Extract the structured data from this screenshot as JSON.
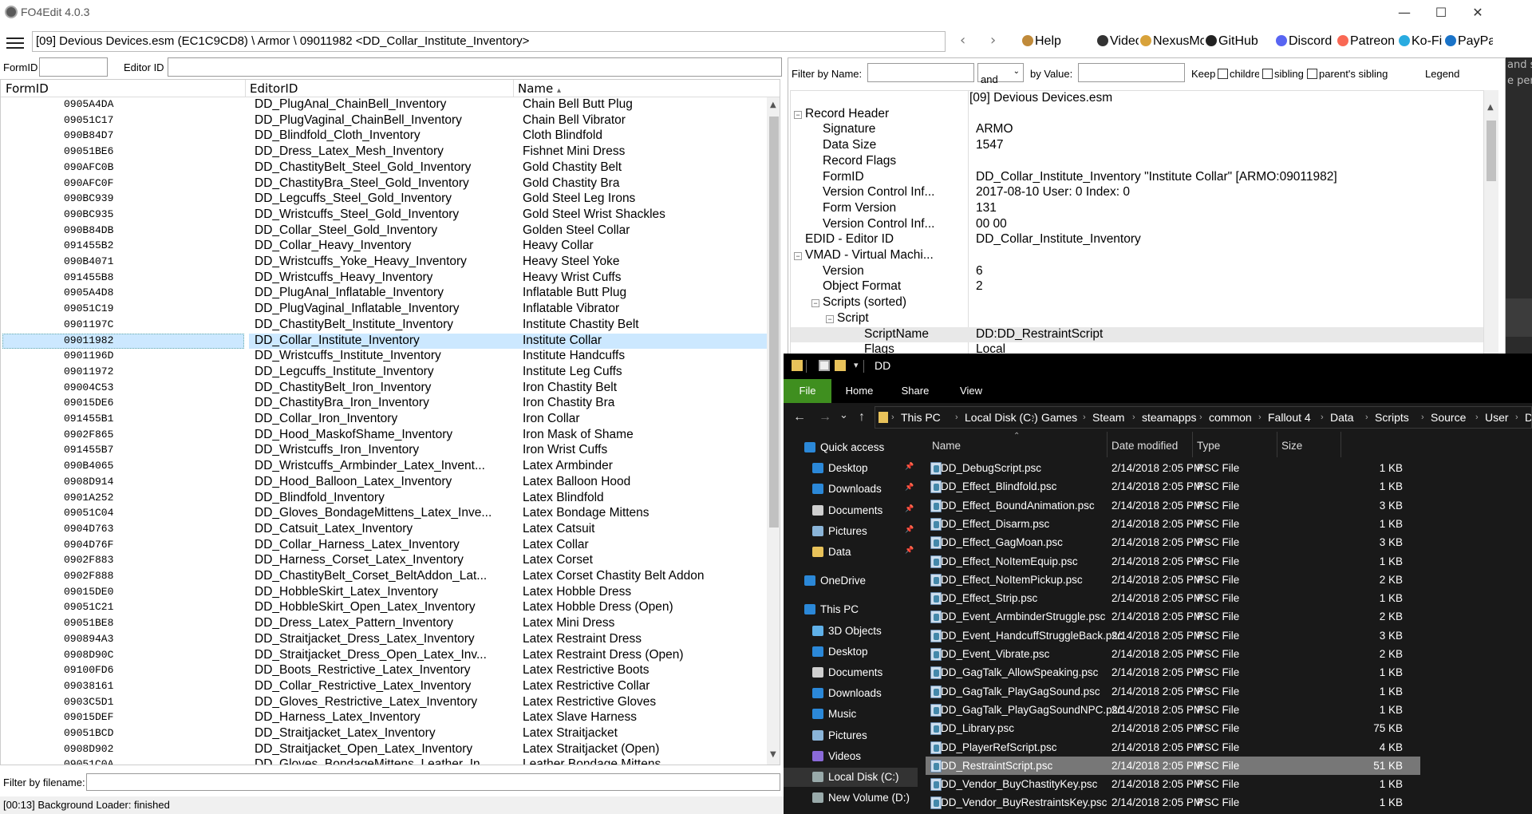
{
  "app": {
    "title": "FO4Edit 4.0.3",
    "path": "[09] Devious Devices.esm (EC1C9CD8) \\ Armor \\ 09011982 <DD_Collar_Institute_Inventory>",
    "window_controls": {
      "minimize": "—",
      "maximize": "☐",
      "close": "✕"
    },
    "nav_back": "‹",
    "nav_forward": "›",
    "links": [
      {
        "label": "Help",
        "icon": "book-icon"
      },
      {
        "label": "Videos",
        "icon": "video-icon"
      },
      {
        "label": "NexusMods",
        "icon": "nexus-icon"
      },
      {
        "label": "GitHub",
        "icon": "github-icon"
      },
      {
        "label": "Discord",
        "icon": "discord-icon"
      },
      {
        "label": "Patreon",
        "icon": "patreon-icon"
      },
      {
        "label": "Ko-Fi",
        "icon": "kofi-icon"
      },
      {
        "label": "PayPal",
        "icon": "paypal-icon"
      }
    ]
  },
  "filters": {
    "formid_label": "FormID",
    "editorid_label": "Editor ID",
    "filename_label": "Filter by filename:"
  },
  "list": {
    "columns": {
      "formid": "FormID",
      "editorid": "EditorID",
      "name": "Name",
      "sort_arrow": "▴"
    },
    "rows": [
      {
        "formid": "0905A4DA",
        "editorid": "DD_PlugAnal_ChainBell_Inventory",
        "name": "Chain Bell Butt Plug"
      },
      {
        "formid": "09051C17",
        "editorid": "DD_PlugVaginal_ChainBell_Inventory",
        "name": "Chain Bell Vibrator"
      },
      {
        "formid": "090B84D7",
        "editorid": "DD_Blindfold_Cloth_Inventory",
        "name": "Cloth Blindfold"
      },
      {
        "formid": "09051BE6",
        "editorid": "DD_Dress_Latex_Mesh_Inventory",
        "name": "Fishnet Mini Dress"
      },
      {
        "formid": "090AFC0B",
        "editorid": "DD_ChastityBelt_Steel_Gold_Inventory",
        "name": "Gold Chastity Belt"
      },
      {
        "formid": "090AFC0F",
        "editorid": "DD_ChastityBra_Steel_Gold_Inventory",
        "name": "Gold Chastity Bra"
      },
      {
        "formid": "090BC939",
        "editorid": "DD_Legcuffs_Steel_Gold_Inventory",
        "name": "Gold Steel Leg Irons"
      },
      {
        "formid": "090BC935",
        "editorid": "DD_Wristcuffs_Steel_Gold_Inventory",
        "name": "Gold Steel Wrist Shackles"
      },
      {
        "formid": "090B84DB",
        "editorid": "DD_Collar_Steel_Gold_Inventory",
        "name": "Golden Steel Collar"
      },
      {
        "formid": "091455B2",
        "editorid": "DD_Collar_Heavy_Inventory",
        "name": "Heavy Collar"
      },
      {
        "formid": "090B4071",
        "editorid": "DD_Wristcuffs_Yoke_Heavy_Inventory",
        "name": "Heavy Steel Yoke"
      },
      {
        "formid": "091455B8",
        "editorid": "DD_Wristcuffs_Heavy_Inventory",
        "name": "Heavy Wrist Cuffs"
      },
      {
        "formid": "0905A4D8",
        "editorid": "DD_PlugAnal_Inflatable_Inventory",
        "name": "Inflatable Butt Plug"
      },
      {
        "formid": "09051C19",
        "editorid": "DD_PlugVaginal_Inflatable_Inventory",
        "name": "Inflatable Vibrator"
      },
      {
        "formid": "0901197C",
        "editorid": "DD_ChastityBelt_Institute_Inventory",
        "name": "Institute Chastity Belt"
      },
      {
        "formid": "09011982",
        "editorid": "DD_Collar_Institute_Inventory",
        "name": "Institute Collar",
        "selected": true
      },
      {
        "formid": "0901196D",
        "editorid": "DD_Wristcuffs_Institute_Inventory",
        "name": "Institute Handcuffs"
      },
      {
        "formid": "09011972",
        "editorid": "DD_Legcuffs_Institute_Inventory",
        "name": "Institute Leg Cuffs"
      },
      {
        "formid": "09004C53",
        "editorid": "DD_ChastityBelt_Iron_Inventory",
        "name": "Iron Chastity Belt"
      },
      {
        "formid": "09015DE6",
        "editorid": "DD_ChastityBra_Iron_Inventory",
        "name": "Iron Chastity Bra"
      },
      {
        "formid": "091455B1",
        "editorid": "DD_Collar_Iron_Inventory",
        "name": "Iron Collar"
      },
      {
        "formid": "0902F865",
        "editorid": "DD_Hood_MaskofShame_Inventory",
        "name": "Iron Mask of Shame"
      },
      {
        "formid": "091455B7",
        "editorid": "DD_Wristcuffs_Iron_Inventory",
        "name": "Iron Wrist Cuffs"
      },
      {
        "formid": "090B4065",
        "editorid": "DD_Wristcuffs_Armbinder_Latex_Invent...",
        "name": "Latex Armbinder"
      },
      {
        "formid": "0908D914",
        "editorid": "DD_Hood_Balloon_Latex_Inventory",
        "name": "Latex Balloon Hood"
      },
      {
        "formid": "0901A252",
        "editorid": "DD_Blindfold_Inventory",
        "name": "Latex Blindfold"
      },
      {
        "formid": "09051C04",
        "editorid": "DD_Gloves_BondageMittens_Latex_Inve...",
        "name": "Latex Bondage Mittens"
      },
      {
        "formid": "0904D763",
        "editorid": "DD_Catsuit_Latex_Inventory",
        "name": "Latex Catsuit"
      },
      {
        "formid": "0904D76F",
        "editorid": "DD_Collar_Harness_Latex_Inventory",
        "name": "Latex Collar"
      },
      {
        "formid": "0902F883",
        "editorid": "DD_Harness_Corset_Latex_Inventory",
        "name": "Latex Corset"
      },
      {
        "formid": "0902F888",
        "editorid": "DD_ChastityBelt_Corset_BeltAddon_Lat...",
        "name": "Latex Corset Chastity Belt Addon"
      },
      {
        "formid": "09015DE0",
        "editorid": "DD_HobbleSkirt_Latex_Inventory",
        "name": "Latex Hobble Dress"
      },
      {
        "formid": "09051C21",
        "editorid": "DD_HobbleSkirt_Open_Latex_Inventory",
        "name": "Latex Hobble Dress (Open)"
      },
      {
        "formid": "09051BE8",
        "editorid": "DD_Dress_Latex_Pattern_Inventory",
        "name": "Latex Mini Dress"
      },
      {
        "formid": "090894A3",
        "editorid": "DD_Straitjacket_Dress_Latex_Inventory",
        "name": "Latex Restraint Dress"
      },
      {
        "formid": "0908D90C",
        "editorid": "DD_Straitjacket_Dress_Open_Latex_Inv...",
        "name": "Latex Restraint Dress (Open)"
      },
      {
        "formid": "09100FD6",
        "editorid": "DD_Boots_Restrictive_Latex_Inventory",
        "name": "Latex Restrictive Boots"
      },
      {
        "formid": "09038161",
        "editorid": "DD_Collar_Restrictive_Latex_Inventory",
        "name": "Latex Restrictive Collar"
      },
      {
        "formid": "0903C5D1",
        "editorid": "DD_Gloves_Restrictive_Latex_Inventory",
        "name": "Latex Restrictive Gloves"
      },
      {
        "formid": "09015DEF",
        "editorid": "DD_Harness_Latex_Inventory",
        "name": "Latex Slave Harness"
      },
      {
        "formid": "09051BCD",
        "editorid": "DD_Straitjacket_Latex_Inventory",
        "name": "Latex Straitjacket"
      },
      {
        "formid": "0908D902",
        "editorid": "DD_Straitjacket_Open_Latex_Inventory",
        "name": "Latex Straitjacket (Open)"
      },
      {
        "formid": "09051C0A",
        "editorid": "DD_Gloves_BondageMittens_Leather_In...",
        "name": "Leather Bondage Mittens"
      }
    ]
  },
  "record": {
    "filter_by_name": "Filter by Name:",
    "and_option": "and",
    "by_value": "by Value:",
    "keep": "Keep",
    "children": "children",
    "siblings": "siblings",
    "parents_sibling": "parent's sibling",
    "legend": "Legend",
    "plugin_header": "[09] Devious Devices.esm",
    "rows": [
      {
        "label": "Record Header",
        "value": "",
        "indent": 0,
        "toggle": "−"
      },
      {
        "label": "Signature",
        "value": "ARMO",
        "indent": 1
      },
      {
        "label": "Data Size",
        "value": "1547",
        "indent": 1
      },
      {
        "label": "Record Flags",
        "value": "",
        "indent": 1
      },
      {
        "label": "FormID",
        "value": "DD_Collar_Institute_Inventory \"Institute Collar\" [ARMO:09011982]",
        "indent": 1
      },
      {
        "label": "Version Control Inf...",
        "value": "2017-08-10 User: 0 Index: 0",
        "indent": 1
      },
      {
        "label": "Form Version",
        "value": "131",
        "indent": 1
      },
      {
        "label": "Version Control Inf...",
        "value": "00 00",
        "indent": 1
      },
      {
        "label": "EDID - Editor ID",
        "value": "DD_Collar_Institute_Inventory",
        "indent": 0
      },
      {
        "label": "VMAD - Virtual Machi...",
        "value": "",
        "indent": 0,
        "toggle": "−"
      },
      {
        "label": "Version",
        "value": "6",
        "indent": 1
      },
      {
        "label": "Object Format",
        "value": "2",
        "indent": 1
      },
      {
        "label": "Scripts (sorted)",
        "value": "",
        "indent": 1,
        "toggle": "−"
      },
      {
        "label": "Script",
        "value": "",
        "indent": 2,
        "toggle": "−"
      },
      {
        "label": "ScriptName",
        "value": "DD:DD_RestraintScript",
        "indent": 3,
        "highlight": true
      },
      {
        "label": "Flags",
        "value": "Local",
        "indent": 3
      }
    ]
  },
  "side_text": {
    "line1": "and sk",
    "line2": "e pers"
  },
  "status": "[00:13] Background Loader: finished",
  "explorer": {
    "title": "DD",
    "ribbon": [
      "File",
      "Home",
      "Share",
      "View"
    ],
    "nav": {
      "back": "←",
      "forward": "→",
      "down": "⌄",
      "up": "↑"
    },
    "breadcrumbs": [
      "This PC",
      "Local Disk (C:)",
      "Games",
      "Steam",
      "steamapps",
      "common",
      "Fallout 4",
      "Data",
      "Scripts",
      "Source",
      "User",
      "DD"
    ],
    "columns": {
      "name": "Name",
      "date": "Date modified",
      "type": "Type",
      "size": "Size"
    },
    "nav_items": [
      {
        "label": "Quick access",
        "icon": "star-icon",
        "pinned": false,
        "indent": 0,
        "color": "#2b88d8"
      },
      {
        "label": "Desktop",
        "icon": "desktop-icon",
        "pinned": true,
        "indent": 1,
        "color": "#2b88d8"
      },
      {
        "label": "Downloads",
        "icon": "downloads-icon",
        "pinned": true,
        "indent": 1,
        "color": "#2b88d8"
      },
      {
        "label": "Documents",
        "icon": "documents-icon",
        "pinned": true,
        "indent": 1,
        "color": "#cfcfcf"
      },
      {
        "label": "Pictures",
        "icon": "pictures-icon",
        "pinned": true,
        "indent": 1,
        "color": "#8ab4d8"
      },
      {
        "label": "Data",
        "icon": "folder-icon",
        "pinned": true,
        "indent": 1,
        "color": "#e8c25a"
      },
      {
        "label": "OneDrive",
        "icon": "cloud-icon",
        "pinned": false,
        "indent": 0,
        "color": "#2b88d8"
      },
      {
        "label": "This PC",
        "icon": "computer-icon",
        "pinned": false,
        "indent": 0,
        "color": "#2b88d8"
      },
      {
        "label": "3D Objects",
        "icon": "cube-icon",
        "pinned": false,
        "indent": 1,
        "color": "#5fb0e8"
      },
      {
        "label": "Desktop",
        "icon": "desktop-icon",
        "pinned": false,
        "indent": 1,
        "color": "#2b88d8"
      },
      {
        "label": "Documents",
        "icon": "documents-icon",
        "pinned": false,
        "indent": 1,
        "color": "#cfcfcf"
      },
      {
        "label": "Downloads",
        "icon": "downloads-icon",
        "pinned": false,
        "indent": 1,
        "color": "#2b88d8"
      },
      {
        "label": "Music",
        "icon": "music-icon",
        "pinned": false,
        "indent": 1,
        "color": "#2b88d8"
      },
      {
        "label": "Pictures",
        "icon": "pictures-icon",
        "pinned": false,
        "indent": 1,
        "color": "#8ab4d8"
      },
      {
        "label": "Videos",
        "icon": "videos-icon",
        "pinned": false,
        "indent": 1,
        "color": "#8a6ad8"
      },
      {
        "label": "Local Disk (C:)",
        "icon": "drive-icon",
        "pinned": false,
        "indent": 1,
        "color": "#9aa",
        "selected": true
      },
      {
        "label": "New Volume (D:)",
        "icon": "drive-icon",
        "pinned": false,
        "indent": 1,
        "color": "#9aa"
      }
    ],
    "files": [
      {
        "name": "DD_DebugScript.psc",
        "date": "2/14/2018 2:05 PM",
        "type": "PSC File",
        "size": "1 KB"
      },
      {
        "name": "DD_Effect_Blindfold.psc",
        "date": "2/14/2018 2:05 PM",
        "type": "PSC File",
        "size": "1 KB"
      },
      {
        "name": "DD_Effect_BoundAnimation.psc",
        "date": "2/14/2018 2:05 PM",
        "type": "PSC File",
        "size": "3 KB"
      },
      {
        "name": "DD_Effect_Disarm.psc",
        "date": "2/14/2018 2:05 PM",
        "type": "PSC File",
        "size": "1 KB"
      },
      {
        "name": "DD_Effect_GagMoan.psc",
        "date": "2/14/2018 2:05 PM",
        "type": "PSC File",
        "size": "3 KB"
      },
      {
        "name": "DD_Effect_NoItemEquip.psc",
        "date": "2/14/2018 2:05 PM",
        "type": "PSC File",
        "size": "1 KB"
      },
      {
        "name": "DD_Effect_NoItemPickup.psc",
        "date": "2/14/2018 2:05 PM",
        "type": "PSC File",
        "size": "2 KB"
      },
      {
        "name": "DD_Effect_Strip.psc",
        "date": "2/14/2018 2:05 PM",
        "type": "PSC File",
        "size": "1 KB"
      },
      {
        "name": "DD_Event_ArmbinderStruggle.psc",
        "date": "2/14/2018 2:05 PM",
        "type": "PSC File",
        "size": "2 KB"
      },
      {
        "name": "DD_Event_HandcuffStruggleBack.psc",
        "date": "2/14/2018 2:05 PM",
        "type": "PSC File",
        "size": "3 KB"
      },
      {
        "name": "DD_Event_Vibrate.psc",
        "date": "2/14/2018 2:05 PM",
        "type": "PSC File",
        "size": "2 KB"
      },
      {
        "name": "DD_GagTalk_AllowSpeaking.psc",
        "date": "2/14/2018 2:05 PM",
        "type": "PSC File",
        "size": "1 KB"
      },
      {
        "name": "DD_GagTalk_PlayGagSound.psc",
        "date": "2/14/2018 2:05 PM",
        "type": "PSC File",
        "size": "1 KB"
      },
      {
        "name": "DD_GagTalk_PlayGagSoundNPC.psc",
        "date": "2/14/2018 2:05 PM",
        "type": "PSC File",
        "size": "1 KB"
      },
      {
        "name": "DD_Library.psc",
        "date": "2/14/2018 2:05 PM",
        "type": "PSC File",
        "size": "75 KB"
      },
      {
        "name": "DD_PlayerRefScript.psc",
        "date": "2/14/2018 2:05 PM",
        "type": "PSC File",
        "size": "4 KB"
      },
      {
        "name": "DD_RestraintScript.psc",
        "date": "2/14/2018 2:05 PM",
        "type": "PSC File",
        "size": "51 KB",
        "selected": true
      },
      {
        "name": "DD_Vendor_BuyChastityKey.psc",
        "date": "2/14/2018 2:05 PM",
        "type": "PSC File",
        "size": "1 KB"
      },
      {
        "name": "DD_Vendor_BuyRestraintsKey.psc",
        "date": "2/14/2018 2:05 PM",
        "type": "PSC File",
        "size": "1 KB"
      }
    ]
  }
}
